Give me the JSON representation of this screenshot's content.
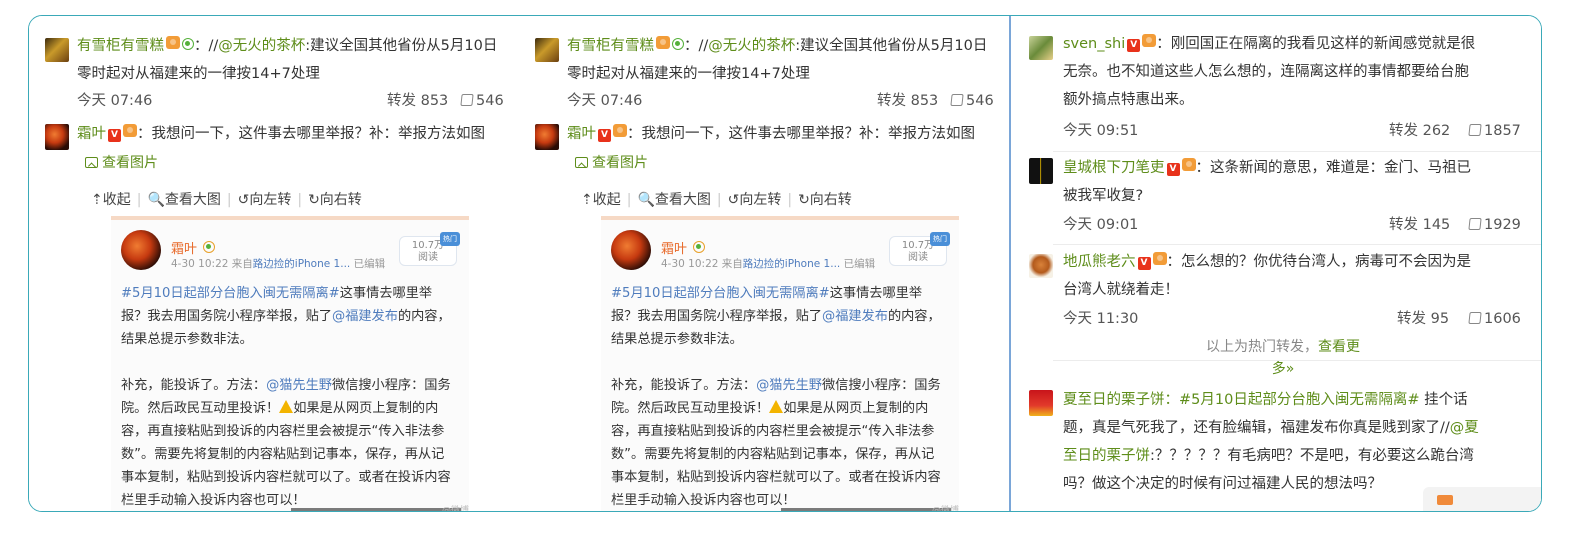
{
  "panels": [
    {
      "comments": [
        {
          "user": "有雪柜有雪糕",
          "sep": "：//",
          "mention": "@无火的茶杯",
          "text_line1": ":建议全国其他省份从5月10日",
          "text_line2": "零时起对从福建来的一律按14+7处理",
          "time": "今天 07:46",
          "repost": "转发 853",
          "likes": "546"
        },
        {
          "user": "霜叶",
          "text": "：我想问一下，这件事去哪里举报？补：举报方法如图",
          "view_pic": "查看图片"
        }
      ],
      "toolbar": [
        "收起",
        "查看大图",
        "向左转",
        "向右转"
      ],
      "screenshot": {
        "name": "霜叶",
        "sub_time": "4-30 10:22",
        "sub_from": "来自",
        "sub_source": "路边捡的iPhone 1...",
        "sub_edited": "已编辑",
        "read_count": "10.7万",
        "read_label": "阅读",
        "hot_tag": "热门",
        "topic": "#5月10日起部分台胞入闽无需隔离#",
        "para1_a": "这事情去哪里举报？我去用国务院小程序举报，贴了",
        "para1_mention": "@福建发布",
        "para1_b": "的内容，结果总提示参数非法。",
        "para2_a": "补充，能投诉了。方法：",
        "para2_mention": "@猫先生野",
        "para2_b": "微信搜小程序：国务院。然后政民互动里投诉！",
        "para2_c": "如果是从网页上复制的内容，再直接粘贴到投诉的内容栏里会被提示“传入非法参数”。需要先将复制的内容粘贴到记事本，保存，再从记事本复制，粘贴到投诉内容栏就可以了。或者在投诉内容栏里手动输入投诉内容也可以！",
        "watermark": "@微博"
      }
    }
  ],
  "right": {
    "comments": [
      {
        "user": "sven_shi",
        "line1": "：刚回国正在隔离的我看见这样的新闻感觉就是很",
        "line2": "无奈。也不知道这些人怎么想的，连隔离这样的事情都要给台胞",
        "line3": "额外搞点特惠出来。",
        "time": "今天 09:51",
        "repost": "转发 262",
        "likes": "1857"
      },
      {
        "user": "皇城根下刀笔吏",
        "line1": "：这条新闻的意思，难道是：金门、马祖已",
        "line2": "被我军收复?",
        "time": "今天 09:01",
        "repost": "转发 145",
        "likes": "1929"
      },
      {
        "user": "地瓜熊老六",
        "line1": "：怎么想的？你优待台湾人，病毒可不会因为是",
        "line2": "台湾人就绕着走！",
        "time": "今天 11:30",
        "repost": "转发 95",
        "likes": "1606"
      }
    ],
    "hot_more_prefix": "以上为热门转发，",
    "hot_more_link_a": "查看更",
    "hot_more_link_b": "多»",
    "last": {
      "user": "夏至日的栗子饼",
      "colon": "：",
      "topic": "#5月10日起部分台胞入闽无需隔离#",
      "line1_tail": " 挂个话",
      "line2": "题，真是气死我了，还有脸编辑，福建发布你真是贱到家了//",
      "mention_a": "@夏",
      "mention_b": "至日的栗子饼",
      "line3_tail": ":？？？？？有毛病吧？不是吧，有必要这么跪台湾",
      "line4": "吗？做这个决定的时候有问过福建人民的想法吗？"
    }
  },
  "colors": {
    "frame": "#3aa9b8",
    "username": "#5e8d1a",
    "mention": "#eb7350",
    "vip_badge": "#e8321b",
    "divider": "#7aa6d8"
  },
  "icons": [
    "user-avatar",
    "vip-badge-icon",
    "level-badge-icon",
    "picture-icon",
    "collapse-icon",
    "zoom-icon",
    "rotate-left-icon",
    "rotate-right-icon",
    "thumbs-up-icon",
    "warning-icon"
  ]
}
